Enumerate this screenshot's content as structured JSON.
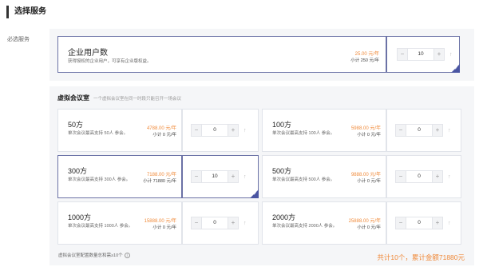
{
  "section": {
    "title": "选择服务",
    "required_label": "必选服务"
  },
  "enterprise": {
    "name": "企业用户数",
    "desc": "获得授权的企业用户，可享有企业版权益。",
    "price": "25.00 元/年",
    "subtotal": "小计 250 元/年",
    "qty": "10"
  },
  "rooms": {
    "title": "虚拟会议室",
    "subtitle": "一个虚拟会议室在同一时段只能召开一场会议",
    "items": [
      {
        "name": "50方",
        "desc": "单次会议最高支持 50人 参会。",
        "price": "4788.00 元/年",
        "subtotal": "小计 0 元/年",
        "qty": "0",
        "selected": false
      },
      {
        "name": "100方",
        "desc": "单次会议最高支持 100人 参会。",
        "price": "5988.00 元/年",
        "subtotal": "小计 0 元/年",
        "qty": "0",
        "selected": false
      },
      {
        "name": "300方",
        "desc": "单次会议最高支持 300人 参会。",
        "price": "7188.00 元/年",
        "subtotal": "小计 71880 元/年",
        "qty": "10",
        "selected": true
      },
      {
        "name": "500方",
        "desc": "单次会议最高支持 500人 参会。",
        "price": "9888.00 元/年",
        "subtotal": "小计 0 元/年",
        "qty": "0",
        "selected": false
      },
      {
        "name": "1000方",
        "desc": "单次会议最高支持 1000人 参会。",
        "price": "15888.00 元/年",
        "subtotal": "小计 0 元/年",
        "qty": "0",
        "selected": false
      },
      {
        "name": "2000方",
        "desc": "单次会议最高支持 2000人 参会。",
        "price": "25888.00 元/年",
        "subtotal": "小计 0 元/年",
        "qty": "0",
        "selected": false
      }
    ]
  },
  "stepper": {
    "minus": "−",
    "plus": "+",
    "up": "↑"
  },
  "footer": {
    "note": "虚拟会议室配置数量总和需≥10个",
    "info_icon": "info-circle-icon",
    "total": "共计10个，累计金额71880元"
  },
  "colors": {
    "accent": "#4a55a2",
    "price": "#f08a3a"
  }
}
